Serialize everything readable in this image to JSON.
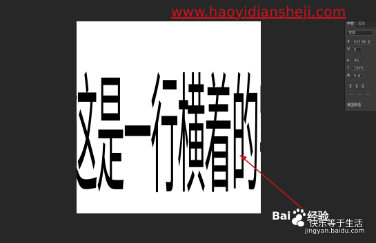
{
  "watermark": {
    "url": "www.haoyidiansheji.com",
    "url_color": "#d0121b"
  },
  "canvas": {
    "text": "这是一行横着的字"
  },
  "character_panel": {
    "tabs": [
      "字符",
      "段落"
    ],
    "font_family": "宋体",
    "rows": [
      {
        "icon": "leading-icon",
        "value": "633.86 点"
      },
      {
        "icon": "kerning-icon",
        "value": "0"
      },
      {
        "icon": "scale-icon",
        "value": "0%"
      },
      {
        "icon": "vertical-scale-icon",
        "value": "100%"
      },
      {
        "icon": "baseline-icon",
        "value": "0 点"
      }
    ],
    "style_buttons": [
      "T",
      "T",
      "T"
    ],
    "language": "美国英语"
  },
  "logo": {
    "baidu_left": "Bai",
    "baidu_right": "经验",
    "baidu_sub": "jingyan.baidu.com",
    "wechat": "快乐等于生活"
  },
  "colors": {
    "background": "#272727",
    "canvas": "#ffffff",
    "arrow": "#c0161c"
  }
}
